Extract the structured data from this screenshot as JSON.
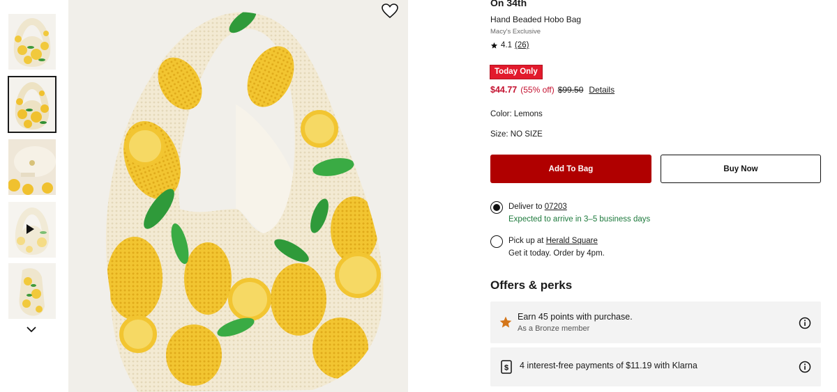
{
  "product": {
    "brand": "On 34th",
    "name": "Hand Beaded Hobo Bag",
    "exclusive": "Macy's Exclusive",
    "rating": "4.1",
    "review_count": "(26)"
  },
  "pricing": {
    "badge": "Today Only",
    "sale_price": "$44.77",
    "discount": "(55% off)",
    "original_price": "$99.50",
    "details_link": "Details"
  },
  "options": {
    "color": "Color: Lemons",
    "size": "Size: NO SIZE"
  },
  "actions": {
    "add_to_bag": "Add To Bag",
    "buy_now": "Buy Now"
  },
  "fulfillment": {
    "deliver_label": "Deliver to",
    "zip": "07203",
    "deliver_eta": "Expected to arrive in 3–5 business days",
    "pickup_label": "Pick up at",
    "store": "Herald Square",
    "pickup_eta": "Get it today. Order by 4pm."
  },
  "offers": {
    "title": "Offers & perks",
    "perk1_title": "Earn 45 points with purchase.",
    "perk1_sub": "As a Bronze member",
    "perk2_title": "4 interest-free payments of $11.19 with Klarna"
  },
  "icons": [
    "heart-icon",
    "star-icon",
    "chevron-down-icon",
    "play-icon",
    "info-icon",
    "dollar-card-icon"
  ],
  "colors": {
    "sale_red": "#c41230",
    "badge_red": "#e21a2c",
    "button_red": "#b00000",
    "eta_green": "#1e7a3d",
    "perk_star": "#d4761a"
  }
}
